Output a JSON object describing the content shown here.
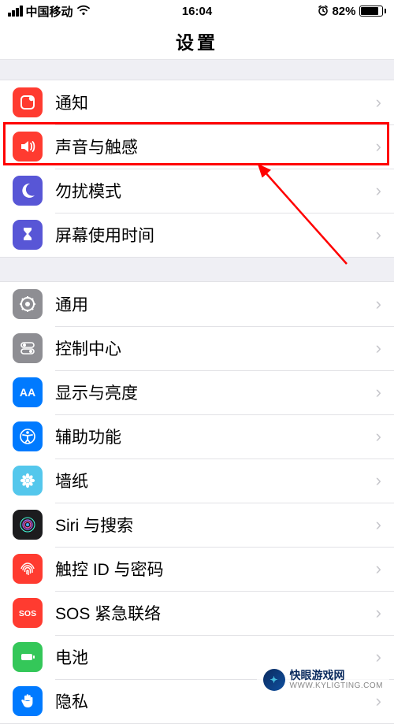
{
  "status": {
    "carrier": "中国移动",
    "time": "16:04",
    "battery_percent": "82%"
  },
  "header": {
    "title": "设置"
  },
  "groups": [
    {
      "rows": [
        {
          "key": "notif",
          "label": "通知",
          "icon_name": "notification-icon"
        },
        {
          "key": "sound",
          "label": "声音与触感",
          "icon_name": "sound-icon",
          "highlighted": true
        },
        {
          "key": "dnd",
          "label": "勿扰模式",
          "icon_name": "moon-icon"
        },
        {
          "key": "screen",
          "label": "屏幕使用时间",
          "icon_name": "hourglass-icon"
        }
      ]
    },
    {
      "rows": [
        {
          "key": "general",
          "label": "通用",
          "icon_name": "gear-icon"
        },
        {
          "key": "control",
          "label": "控制中心",
          "icon_name": "switches-icon"
        },
        {
          "key": "display",
          "label": "显示与亮度",
          "icon_name": "aa-icon"
        },
        {
          "key": "access",
          "label": "辅助功能",
          "icon_name": "accessibility-icon"
        },
        {
          "key": "wall",
          "label": "墙纸",
          "icon_name": "flower-icon"
        },
        {
          "key": "siri",
          "label": "Siri 与搜索",
          "icon_name": "siri-icon"
        },
        {
          "key": "touchid",
          "label": "触控 ID 与密码",
          "icon_name": "fingerprint-icon"
        },
        {
          "key": "sos",
          "label": "SOS 紧急联络",
          "icon_name": "sos-icon"
        },
        {
          "key": "battery",
          "label": "电池",
          "icon_name": "battery-icon"
        },
        {
          "key": "privacy",
          "label": "隐私",
          "icon_name": "hand-icon"
        }
      ]
    }
  ],
  "annotation": {
    "highlight_row_key": "sound",
    "arrow": true
  },
  "watermark": {
    "brand": "快眼游戏网",
    "url": "WWW.KYLIGTING.COM"
  },
  "sos_text": "SOS"
}
